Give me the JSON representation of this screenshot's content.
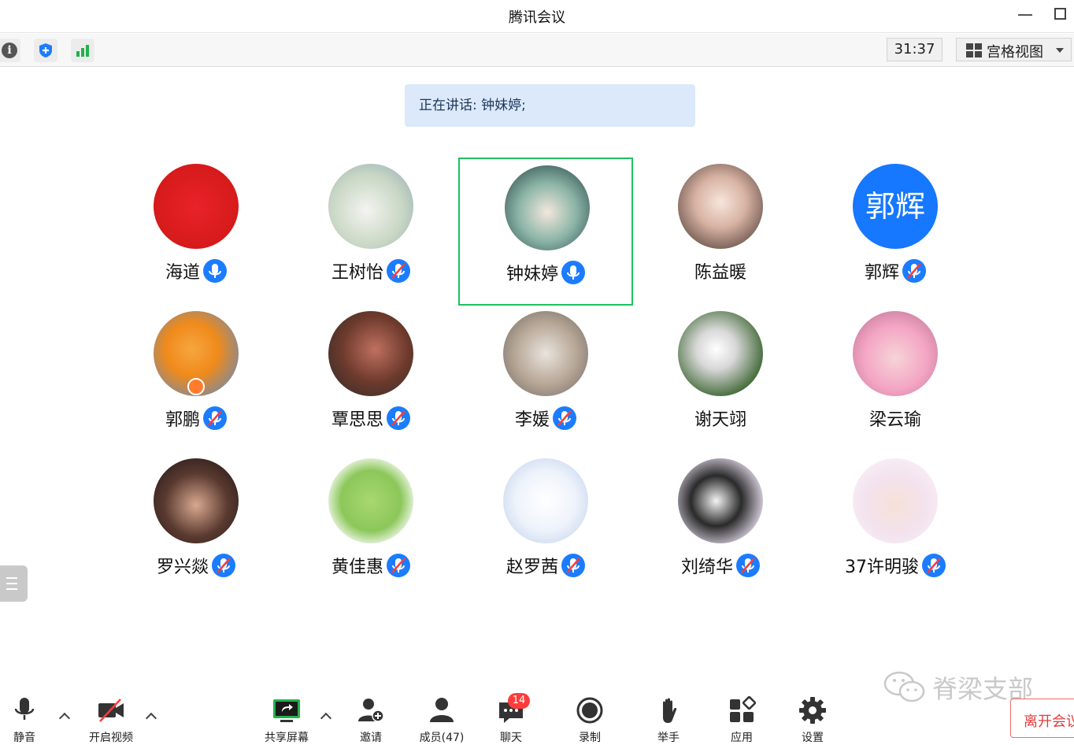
{
  "window": {
    "title": "腾讯会议"
  },
  "toolbar": {
    "timer": "31:37",
    "view_mode": "宫格视图"
  },
  "speaking_banner": "正在讲话: 钟妹婷;",
  "participants": [
    {
      "name": "海道",
      "mic": "on",
      "avatar_text": ""
    },
    {
      "name": "王树怡",
      "mic": "muted",
      "avatar_text": ""
    },
    {
      "name": "钟妹婷",
      "mic": "on",
      "avatar_text": "",
      "active_speaker": true
    },
    {
      "name": "陈益暖",
      "mic": "none",
      "avatar_text": ""
    },
    {
      "name": "郭辉",
      "mic": "muted",
      "avatar_text": "郭辉"
    },
    {
      "name": "郭鹏",
      "mic": "muted",
      "avatar_text": "",
      "host": true
    },
    {
      "name": "覃思思",
      "mic": "muted",
      "avatar_text": ""
    },
    {
      "name": "李媛",
      "mic": "muted",
      "avatar_text": ""
    },
    {
      "name": "谢天翊",
      "mic": "none",
      "avatar_text": ""
    },
    {
      "name": "梁云瑜",
      "mic": "none",
      "avatar_text": ""
    },
    {
      "name": "罗兴燚",
      "mic": "muted",
      "avatar_text": ""
    },
    {
      "name": "黄佳惠",
      "mic": "muted",
      "avatar_text": ""
    },
    {
      "name": "赵罗茜",
      "mic": "muted",
      "avatar_text": ""
    },
    {
      "name": "刘绮华",
      "mic": "muted",
      "avatar_text": ""
    },
    {
      "name": "37许明骏",
      "mic": "muted",
      "avatar_text": ""
    }
  ],
  "bottom_bar": {
    "mute_label": "静音",
    "video_label": "开启视频",
    "share_label": "共享屏幕",
    "invite_label": "邀请",
    "members_label": "成员(47)",
    "chat_label": "聊天",
    "chat_badge": "14",
    "record_label": "录制",
    "raise_hand_label": "举手",
    "apps_label": "应用",
    "settings_label": "设置"
  },
  "watermark_text": "脊梁支部",
  "leave_label": "离开会议",
  "colors": {
    "accent": "#1b7cff",
    "active_border": "#1ec25f",
    "danger": "#e23c3c",
    "banner_bg": "#dbe9fb"
  }
}
